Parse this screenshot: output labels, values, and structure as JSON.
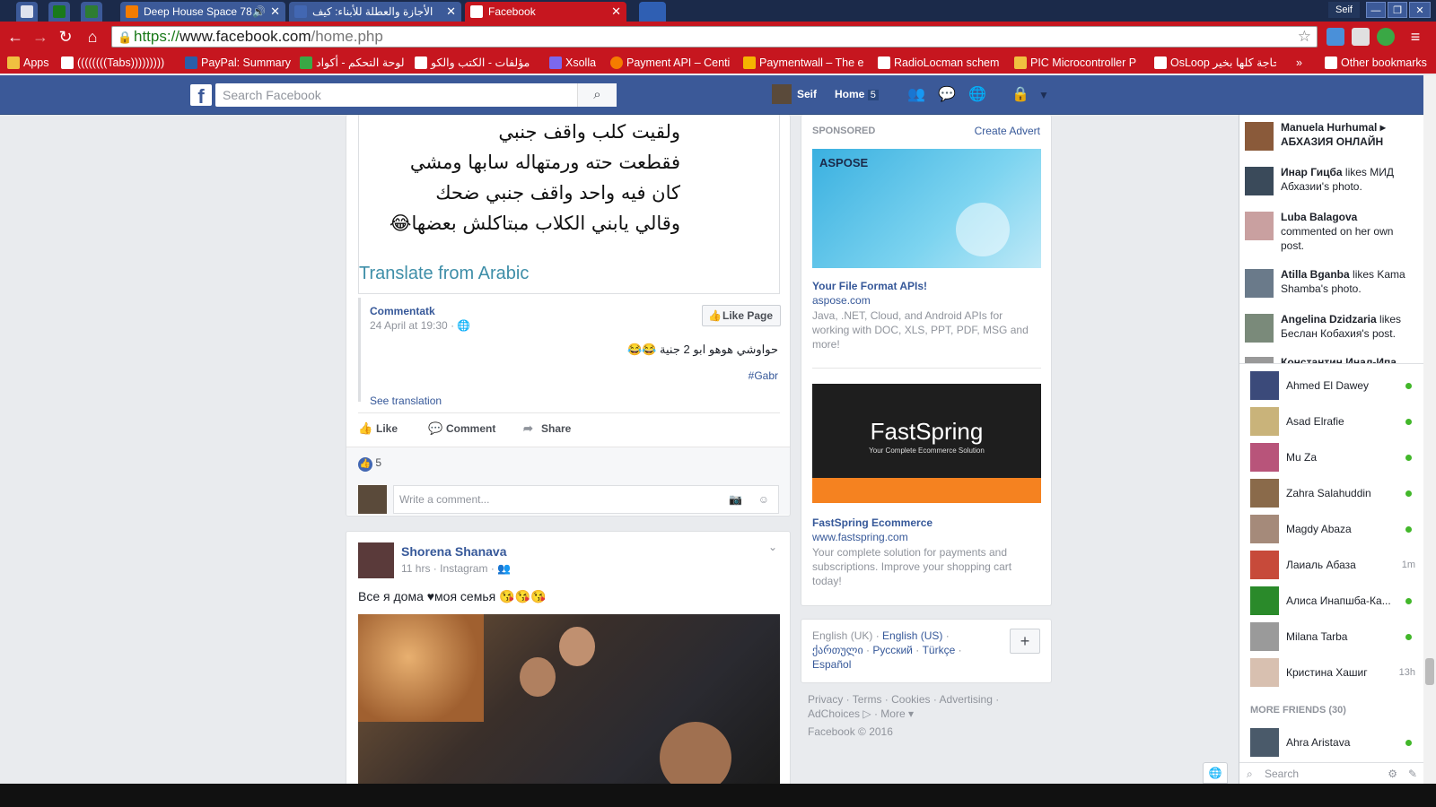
{
  "browser": {
    "tabs": [
      {
        "label": "",
        "color": "#dfe3ee"
      },
      {
        "label": "",
        "color": "#1a7a1a"
      },
      {
        "label": "",
        "color": "#2e7d32"
      },
      {
        "label": "Deep House Space 78",
        "color": "#f57c00"
      },
      {
        "label": "الأجازة والعطلة للأبناء: كيف",
        "color": "#4267b2"
      },
      {
        "label": "Facebook",
        "color": "#ffffff"
      },
      {
        "label": "",
        "color": "#2f5fb3"
      }
    ],
    "user": "Seif",
    "url": {
      "scheme": "https://",
      "host": "www.facebook.com",
      "path": "/home.php"
    },
    "bookmarks": [
      "Apps",
      "((((((((Tabs)))))))))",
      "PayPal: Summary",
      "لوحة التحكم - أكواد",
      "مؤلفات - الكتب والكو",
      "Xsolla",
      "Payment API – Centi",
      "Paymentwall – The e",
      "RadioLocman schem",
      "PIC Microcontroller P",
      "OsLoop حاجة كلها بخير",
      "»",
      "Other bookmarks"
    ]
  },
  "fb": {
    "search_placeholder": "Search Facebook",
    "user_name": "Seif",
    "home_label": "Home",
    "home_count": "5"
  },
  "post1": {
    "arabic_lines": [
      "ولقيت كلب واقف جنبي",
      "فقطعت حته ورمتهاله سابها ومشي",
      "كان فيه واحد واقف جنبي ضحك",
      "وقالي يابني الكلاب مبتاكلش بعضها😂"
    ],
    "translate": "Translate from Arabic",
    "page_name": "Commentatk",
    "time": "24 April at 19:30 ·",
    "like_page": "Like Page",
    "caption": "حواوشي هوهو ابو 2 جنية 😂😂",
    "hashtag": "#Gabr",
    "see_translation": "See translation",
    "actions": {
      "like": "Like",
      "comment": "Comment",
      "share": "Share"
    },
    "likes": "5",
    "comment_placeholder": "Write a comment..."
  },
  "post2": {
    "author": "Shorena Shanava",
    "meta": "11 hrs · Instagram ·",
    "text": "Все я дома ♥моя семья 😘😘😘"
  },
  "sponsored": {
    "heading": "SPONSORED",
    "create": "Create Advert",
    "ads": [
      {
        "brand": "ASPOSE",
        "title": "Your File Format APIs!",
        "domain": "aspose.com",
        "desc": "Java, .NET, Cloud, and Android APIs for working with DOC, XLS, PPT, PDF, MSG and more!"
      },
      {
        "brand": "FastSpring",
        "tagline": "Your Complete Ecommerce Solution",
        "title": "FastSpring Ecommerce",
        "domain": "www.fastspring.com",
        "desc": "Your complete solution for payments and subscriptions. Improve your shopping cart today!"
      }
    ]
  },
  "languages": {
    "current": "English (UK)",
    "links": [
      "English (US)",
      "ქართული",
      "Русский",
      "Türkçe",
      "Español"
    ]
  },
  "footer": {
    "links": [
      "Privacy",
      "Terms",
      "Cookies",
      "Advertising",
      "AdChoices",
      "More"
    ],
    "copyright": "Facebook © 2016"
  },
  "ticker": [
    {
      "name": "Manuela Hurhumal",
      "rest": "▸ АБХАЗИЯ ОНЛАЙН"
    },
    {
      "name": "Инар Гицба",
      "rest": "likes МИД Абхазии's photo."
    },
    {
      "name": "Luba Balagova",
      "rest": "commented on her own post."
    },
    {
      "name": "Atilla Bganba",
      "rest": "likes Kama Shamba's photo."
    },
    {
      "name": "Angelina Dzidzaria",
      "rest": "likes Беслан Кобахия's post."
    },
    {
      "name": "Константин Инал-Ипа",
      "rest": ""
    }
  ],
  "friends": [
    {
      "name": "Ahmed El Dawey",
      "status": "online",
      "color": "#3b4a7a"
    },
    {
      "name": "Asad Elrafie",
      "status": "online",
      "color": "#c9b37a"
    },
    {
      "name": "Mu Za",
      "status": "online",
      "color": "#b8547a"
    },
    {
      "name": "Zahra Salahuddin",
      "status": "online",
      "color": "#8a6a4a"
    },
    {
      "name": "Magdy Abaza",
      "status": "online",
      "color": "#a58a7a"
    },
    {
      "name": "Лаиаль Абаза",
      "status": "1m",
      "color": "#c74a3a"
    },
    {
      "name": "Алиса Инапшба-Ка...",
      "status": "online",
      "color": "#2a8a2a"
    },
    {
      "name": "Milana Tarba",
      "status": "online",
      "color": "#9a9a9a"
    },
    {
      "name": "Кристина Хашиг",
      "status": "13h",
      "color": "#d8c0b0"
    }
  ],
  "more_friends": "MORE FRIENDS (30)",
  "more_friend": {
    "name": "Ahra Aristava",
    "status": "online"
  },
  "chat_search": "Search"
}
